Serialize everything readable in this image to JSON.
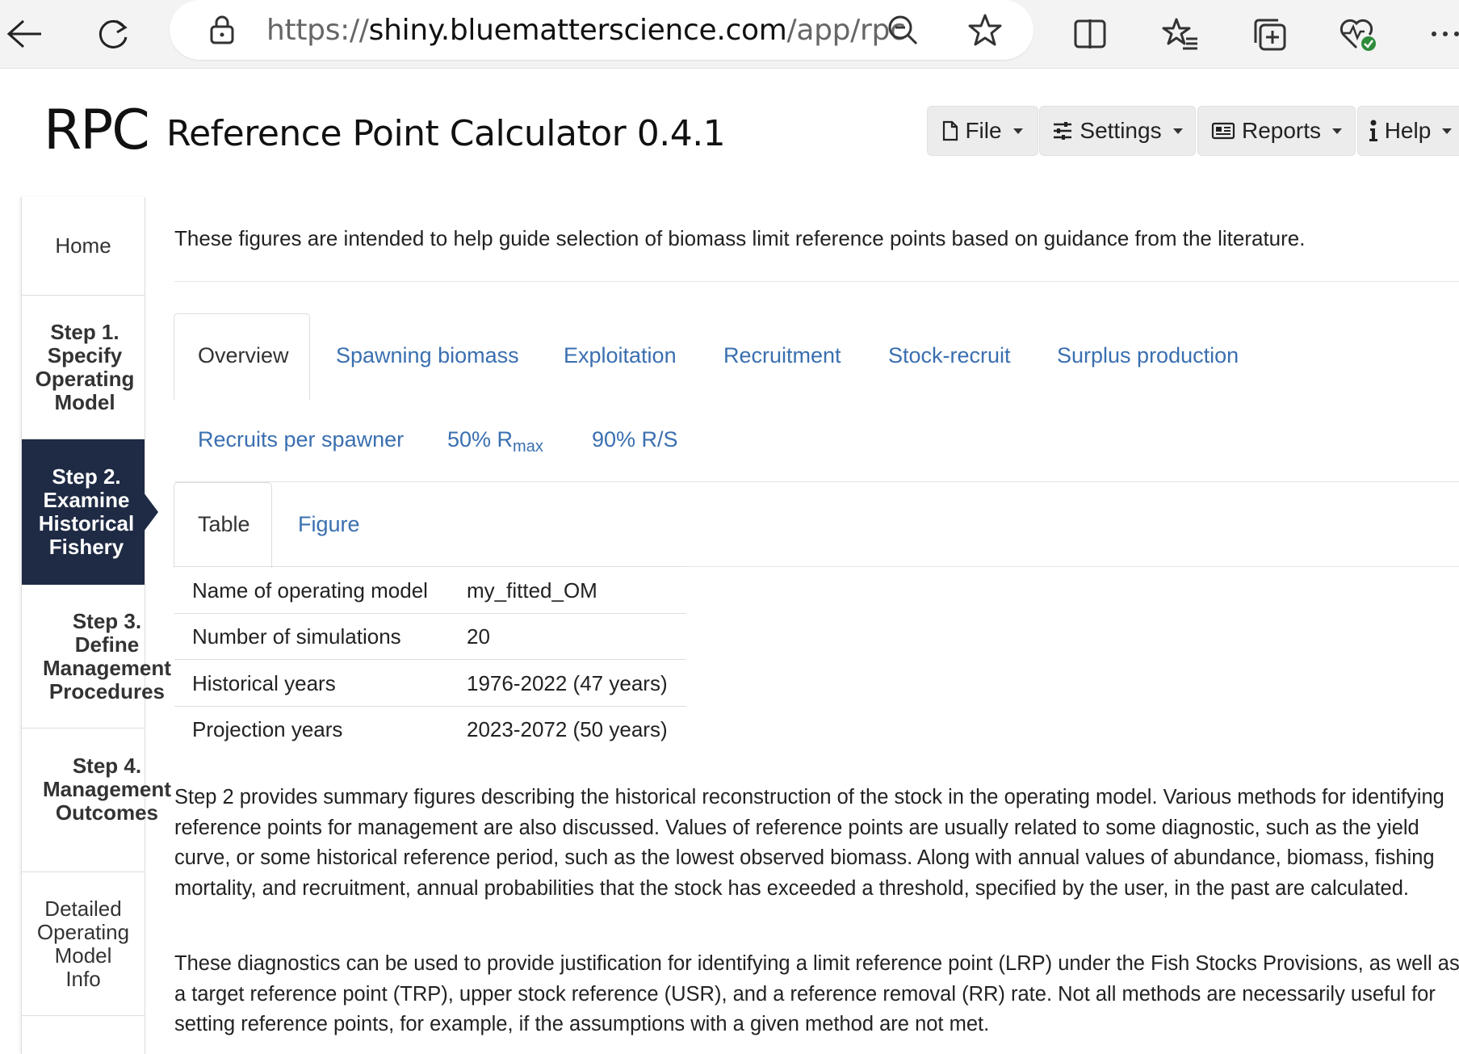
{
  "browser": {
    "url_scheme": "https://",
    "url_host": "shiny.bluematterscience.com",
    "url_path": "/app/rpc",
    "icons": [
      "back-icon",
      "refresh-icon",
      "lock-icon",
      "zoom-out-icon",
      "star-icon",
      "split-screen-icon",
      "favorites-icon",
      "collections-icon",
      "health-icon",
      "more-icon"
    ]
  },
  "header": {
    "brand": "RPC",
    "title": "Reference Point Calculator 0.4.1",
    "menus": [
      "File",
      "Settings",
      "Reports",
      "Help"
    ]
  },
  "sidebar": {
    "items": [
      {
        "label": "Home"
      },
      {
        "label_lines": [
          "Step 1.",
          "Specify",
          "Operating",
          "Model"
        ]
      },
      {
        "label_lines": [
          "Step 2.",
          "Examine",
          "Historical",
          "Fishery"
        ]
      },
      {
        "label_lines": [
          "Step 3.",
          "Define",
          "Management",
          "Procedures"
        ]
      },
      {
        "label_lines": [
          "Step 4.",
          "Management",
          "Outcomes"
        ]
      },
      {
        "label_lines": [
          "Detailed",
          "Operating",
          "Model",
          "Info"
        ]
      }
    ]
  },
  "main": {
    "intro": "These figures are intended to help guide selection of biomass limit reference points based on guidance from the literature.",
    "tabs_row1": [
      "Overview",
      "Spawning biomass",
      "Exploitation",
      "Recruitment",
      "Stock-recruit",
      "Surplus production"
    ],
    "tabs_row2": [
      "Recruits per spawner",
      "50% R",
      "max",
      "90% R/S"
    ],
    "subtabs": [
      "Table",
      "Figure"
    ],
    "table": [
      [
        "Name of operating model",
        "my_fitted_OM"
      ],
      [
        "Number of simulations",
        "20"
      ],
      [
        "Historical years",
        "1976-2022 (47 years)"
      ],
      [
        "Projection years",
        "2023-2072 (50 years)"
      ]
    ],
    "para1": "Step 2 provides summary figures describing the historical reconstruction of the stock in the operating model. Various methods for identifying reference points for management are also discussed. Values of reference points are usually related to some diagnostic, such as the yield curve, or some historical reference period, such as the lowest observed biomass. Along with annual values of abundance, biomass, fishing mortality, and recruitment, annual probabilities that the stock has exceeded a threshold, specified by the user, in the past are calculated.",
    "para2": "These diagnostics can be used to provide justification for identifying a limit reference point (LRP) under the Fish Stocks Provisions, as well as a target reference point (TRP), upper stock reference (USR), and a reference removal (RR) rate. Not all methods are necessarily useful for setting reference points, for example, if the assumptions with a given method are not met."
  }
}
